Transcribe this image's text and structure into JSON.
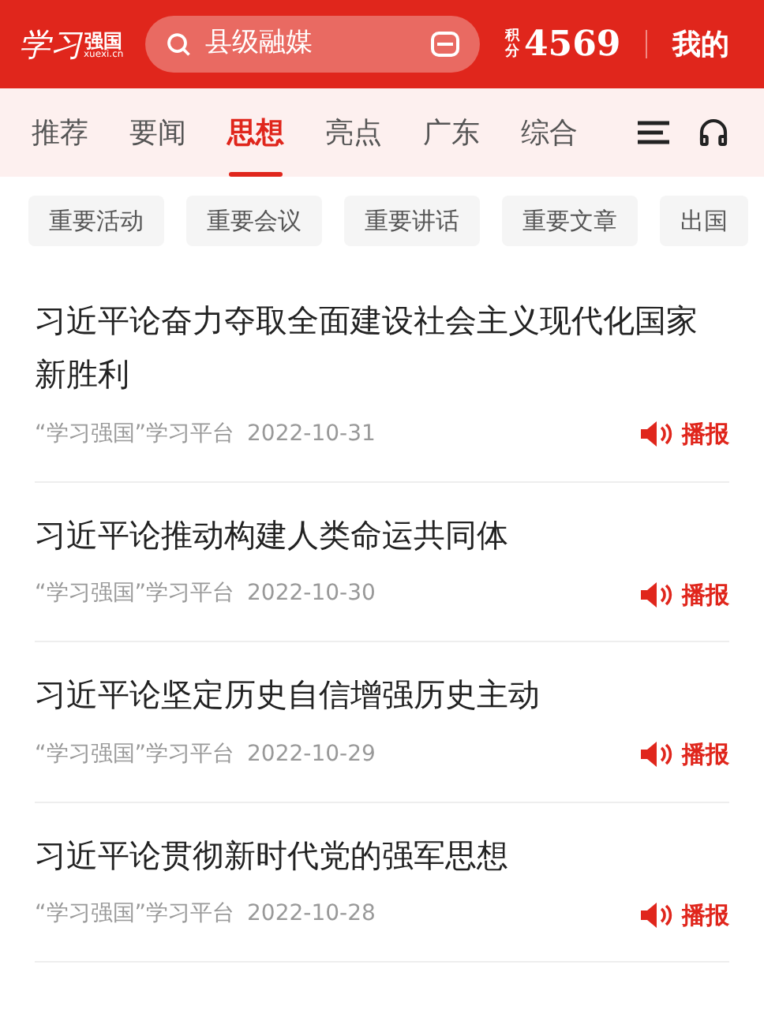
{
  "header": {
    "logo": {
      "script": "学习",
      "name": "强国",
      "domain": "xuexi.cn"
    },
    "search": {
      "placeholder": "县级融媒"
    },
    "points": {
      "label": "积分",
      "value": "4569"
    },
    "mine": "我的"
  },
  "tabs": [
    {
      "label": "推荐",
      "selected": false
    },
    {
      "label": "要闻",
      "selected": false
    },
    {
      "label": "思想",
      "selected": true
    },
    {
      "label": "亮点",
      "selected": false
    },
    {
      "label": "广东",
      "selected": false
    },
    {
      "label": "综合",
      "selected": false
    }
  ],
  "chips": [
    "重要活动",
    "重要会议",
    "重要讲话",
    "重要文章",
    "出国"
  ],
  "articles": [
    {
      "title": "习近平论奋力夺取全面建设社会主义现代化国家新胜利",
      "source": "“学习强国”学习平台",
      "date": "2022-10-31",
      "action": "播报"
    },
    {
      "title": "习近平论推动构建人类命运共同体",
      "source": "“学习强国”学习平台",
      "date": "2022-10-30",
      "action": "播报"
    },
    {
      "title": "习近平论坚定历史自信增强历史主动",
      "source": "“学习强国”学习平台",
      "date": "2022-10-29",
      "action": "播报"
    },
    {
      "title": "习近平论贯彻新时代党的强军思想",
      "source": "“学习强国”学习平台",
      "date": "2022-10-28",
      "action": "播报"
    }
  ]
}
